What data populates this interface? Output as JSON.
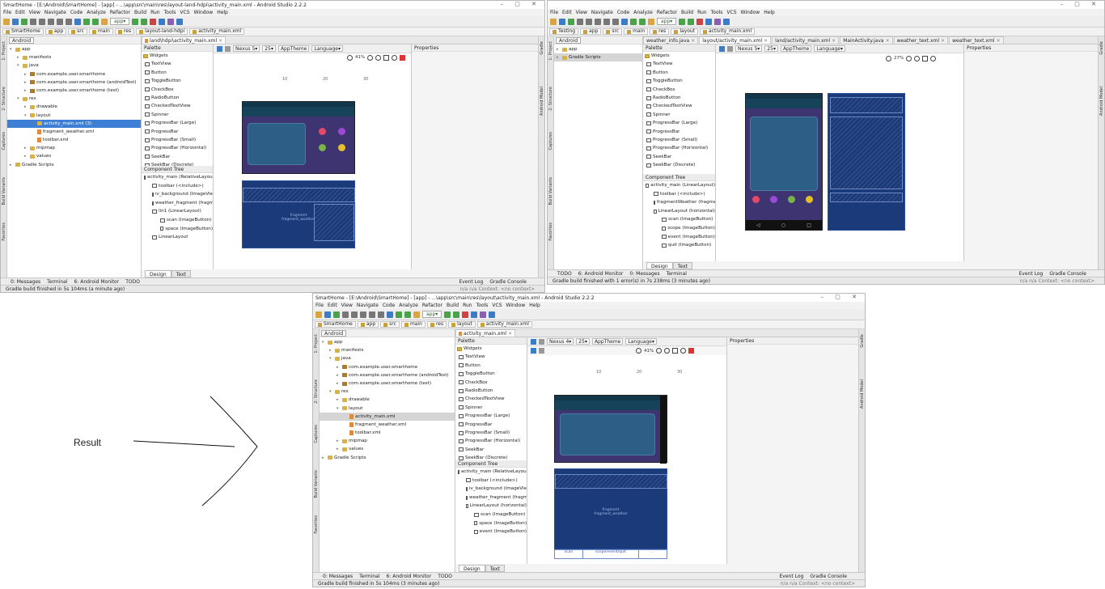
{
  "result_label": "Result",
  "menu": [
    "File",
    "Edit",
    "View",
    "Navigate",
    "Code",
    "Analyze",
    "Refactor",
    "Build",
    "Run",
    "Tools",
    "VCS",
    "Window",
    "Help"
  ],
  "app_selector": "app",
  "win1": {
    "title": "SmartHome - [E:\\Android\\SmartHome] - [app] - ...\\app\\src\\main\\res\\layout-land-hdpi\\activity_main.xml - Android Studio 2.2.2",
    "crumbs": [
      "SmartHome",
      "app",
      "src",
      "main",
      "res",
      "layout-land-hdpi",
      "activity_main.xml"
    ],
    "project_dropdown": "Android",
    "editor_tab": "land\\hdpi\\activity_main.xml",
    "tree": [
      {
        "label": "app",
        "depth": 0,
        "arrow": "▾",
        "icon": "fo"
      },
      {
        "label": "manifests",
        "depth": 1,
        "arrow": "▸",
        "icon": "fo"
      },
      {
        "label": "java",
        "depth": 1,
        "arrow": "▾",
        "icon": "fo"
      },
      {
        "label": "com.example.user.smarthome",
        "depth": 2,
        "arrow": "▸",
        "icon": "pk"
      },
      {
        "label": "com.example.user.smarthome (androidTest)",
        "depth": 2,
        "arrow": "▸",
        "icon": "pk"
      },
      {
        "label": "com.example.user.smarthome (test)",
        "depth": 2,
        "arrow": "▸",
        "icon": "pk"
      },
      {
        "label": "res",
        "depth": 1,
        "arrow": "▾",
        "icon": "fo"
      },
      {
        "label": "drawable",
        "depth": 2,
        "arrow": "▸",
        "icon": "fo"
      },
      {
        "label": "layout",
        "depth": 2,
        "arrow": "▾",
        "icon": "fo"
      },
      {
        "label": "activity_main.xml (3)",
        "depth": 3,
        "arrow": "▸",
        "icon": "fo",
        "sel": true
      },
      {
        "label": "fragment_weather.xml",
        "depth": 3,
        "arrow": "",
        "icon": "xm"
      },
      {
        "label": "toolbar.xml",
        "depth": 3,
        "arrow": "",
        "icon": "xm"
      },
      {
        "label": "mipmap",
        "depth": 2,
        "arrow": "▸",
        "icon": "fo"
      },
      {
        "label": "values",
        "depth": 2,
        "arrow": "▸",
        "icon": "fo"
      },
      {
        "label": "Gradle Scripts",
        "depth": 0,
        "arrow": "▸",
        "icon": "fo"
      }
    ],
    "palette_title": "Palette",
    "palette": [
      {
        "label": "Widgets",
        "cat": true
      },
      {
        "label": "TextView"
      },
      {
        "label": "Button"
      },
      {
        "label": "ToggleButton"
      },
      {
        "label": "CheckBox"
      },
      {
        "label": "RadioButton"
      },
      {
        "label": "CheckedTextView"
      },
      {
        "label": "Spinner"
      },
      {
        "label": "ProgressBar (Large)"
      },
      {
        "label": "ProgressBar"
      },
      {
        "label": "ProgressBar (Small)"
      },
      {
        "label": "ProgressBar (Horizontal)"
      },
      {
        "label": "SeekBar"
      },
      {
        "label": "SeekBar (Discrete)"
      }
    ],
    "ctree_title": "Component Tree",
    "ctree": [
      {
        "label": "activity_main (RelativeLayout)",
        "depth": 0
      },
      {
        "label": "toolbar (<include>)",
        "depth": 1
      },
      {
        "label": "iv_background (ImageView)",
        "depth": 1
      },
      {
        "label": "weather_fragment (fragment)",
        "depth": 1
      },
      {
        "label": "lin1 (LinearLayout)",
        "depth": 1
      },
      {
        "label": "scan (ImageButton)",
        "depth": 2
      },
      {
        "label": "space (ImageButton)",
        "depth": 2
      },
      {
        "label": "LinearLayout",
        "depth": 1
      }
    ],
    "device": "Nexus 5",
    "api": "25",
    "theme": "AppTheme",
    "language": "Language",
    "zoom": "41%",
    "props_title": "Properties",
    "ruler": [
      "10",
      "20",
      "30"
    ],
    "fragment_label": "fragment\nfragment_weather",
    "design_tab": "Design",
    "text_tab": "Text",
    "bottom_tabs": [
      "0: Messages",
      "Terminal",
      "6: Android Monitor",
      "TODO"
    ],
    "right_bottom": [
      "Event Log",
      "Gradle Console"
    ],
    "status": "Gradle build finished in 5s 104ms (a minute ago)",
    "status_right": "n/a   n/a   Context: <no context>"
  },
  "win2": {
    "crumbs": [
      "Testing",
      "app",
      "src",
      "main",
      "res",
      "layout",
      "activity_main.xml"
    ],
    "project_dropdown": "Android",
    "editor_tabs": [
      "weather_info.java",
      "layout/activity_main.xml",
      "land/activity_main.xml",
      "MainActivity.java",
      "weather_text.xml",
      "weather_text.xml"
    ],
    "tree": [
      {
        "label": "app",
        "depth": 0,
        "arrow": "▸",
        "icon": "fo"
      },
      {
        "label": "Gradle Scripts",
        "depth": 0,
        "arrow": "▸",
        "icon": "fo",
        "sel2": true
      }
    ],
    "palette_title": "Palette",
    "palette": [
      {
        "label": "Widgets",
        "cat": true
      },
      {
        "label": "TextView"
      },
      {
        "label": "Button"
      },
      {
        "label": "ToggleButton"
      },
      {
        "label": "CheckBox"
      },
      {
        "label": "RadioButton"
      },
      {
        "label": "CheckedTextView"
      },
      {
        "label": "Spinner"
      },
      {
        "label": "ProgressBar (Large)"
      },
      {
        "label": "ProgressBar"
      },
      {
        "label": "ProgressBar (Small)"
      },
      {
        "label": "ProgressBar (Horizontal)"
      },
      {
        "label": "SeekBar"
      },
      {
        "label": "SeekBar (Discrete)"
      }
    ],
    "ctree_title": "Component Tree",
    "ctree": [
      {
        "label": "activity_main (LinearLayout)",
        "depth": 0
      },
      {
        "label": "toolbar (<include>)",
        "depth": 1
      },
      {
        "label": "fragmentWeather (fragment)",
        "depth": 1
      },
      {
        "label": "LinearLayout (horizontal)",
        "depth": 1
      },
      {
        "label": "scan (ImageButton)",
        "depth": 2
      },
      {
        "label": "scope (ImageButton)",
        "depth": 2
      },
      {
        "label": "event (ImageButton)",
        "depth": 2
      },
      {
        "label": "quit (ImageButton)",
        "depth": 2
      }
    ],
    "device": "Nexus 5",
    "api": "25",
    "theme": "AppTheme",
    "language": "Language",
    "zoom": "27%",
    "props_title": "Properties",
    "design_tab": "Design",
    "text_tab": "Text",
    "bottom_tabs": [
      "TODO",
      "6: Android Monitor",
      "0: Messages",
      "Terminal"
    ],
    "right_bottom": [
      "Event Log",
      "Gradle Console"
    ],
    "status": "Gradle build finished with 1 error(s) in 7s 238ms (3 minutes ago)",
    "status_right": "n/a   n/a   Context: <no context>"
  },
  "win3": {
    "title": "SmartHome - [E:\\Android\\SmartHome] - [app] - ...\\app\\src\\main\\res\\layout\\activity_main.xml - Android Studio 2.2.2",
    "crumbs": [
      "SmartHome",
      "app",
      "src",
      "main",
      "res",
      "layout",
      "activity_main.xml"
    ],
    "project_dropdown": "Android",
    "editor_tab": "activity_main.xml",
    "tree": [
      {
        "label": "app",
        "depth": 0,
        "arrow": "▾",
        "icon": "fo"
      },
      {
        "label": "manifests",
        "depth": 1,
        "arrow": "▸",
        "icon": "fo"
      },
      {
        "label": "java",
        "depth": 1,
        "arrow": "▾",
        "icon": "fo"
      },
      {
        "label": "com.example.user.smarthome",
        "depth": 2,
        "arrow": "▸",
        "icon": "pk"
      },
      {
        "label": "com.example.user.smarthome (androidTest)",
        "depth": 2,
        "arrow": "▸",
        "icon": "pk"
      },
      {
        "label": "com.example.user.smarthome (test)",
        "depth": 2,
        "arrow": "▸",
        "icon": "pk"
      },
      {
        "label": "res",
        "depth": 1,
        "arrow": "▾",
        "icon": "fo"
      },
      {
        "label": "drawable",
        "depth": 2,
        "arrow": "▸",
        "icon": "fo"
      },
      {
        "label": "layout",
        "depth": 2,
        "arrow": "▾",
        "icon": "fo"
      },
      {
        "label": "activity_main.xml",
        "depth": 3,
        "arrow": "",
        "icon": "xm",
        "sel2": true
      },
      {
        "label": "fragment_weather.xml",
        "depth": 3,
        "arrow": "",
        "icon": "xm"
      },
      {
        "label": "toolbar.xml",
        "depth": 3,
        "arrow": "",
        "icon": "xm"
      },
      {
        "label": "mipmap",
        "depth": 2,
        "arrow": "▸",
        "icon": "fo"
      },
      {
        "label": "values",
        "depth": 2,
        "arrow": "▸",
        "icon": "fo"
      },
      {
        "label": "Gradle Scripts",
        "depth": 0,
        "arrow": "▸",
        "icon": "fo"
      }
    ],
    "palette_title": "Palette",
    "palette": [
      {
        "label": "Widgets",
        "cat": true
      },
      {
        "label": "TextView"
      },
      {
        "label": "Button"
      },
      {
        "label": "ToggleButton"
      },
      {
        "label": "CheckBox"
      },
      {
        "label": "RadioButton"
      },
      {
        "label": "CheckedTextView"
      },
      {
        "label": "Spinner"
      },
      {
        "label": "ProgressBar (Large)"
      },
      {
        "label": "ProgressBar"
      },
      {
        "label": "ProgressBar (Small)"
      },
      {
        "label": "ProgressBar (Horizontal)"
      },
      {
        "label": "SeekBar"
      },
      {
        "label": "SeekBar (Discrete)"
      }
    ],
    "ctree_title": "Component Tree",
    "ctree": [
      {
        "label": "activity_main (RelativeLayout)",
        "depth": 0
      },
      {
        "label": "toolbar (<include>)",
        "depth": 1
      },
      {
        "label": "iv_background (ImageView)",
        "depth": 1
      },
      {
        "label": "weather_fragment (fragment)",
        "depth": 1
      },
      {
        "label": "LinearLayout (horizontal)",
        "depth": 1
      },
      {
        "label": "scan (ImageButton)",
        "depth": 2
      },
      {
        "label": "space (ImageButton)",
        "depth": 2
      },
      {
        "label": "event (ImageButton)",
        "depth": 2
      }
    ],
    "device": "Nexus 4",
    "api": "25",
    "theme": "AppTheme",
    "language": "Language",
    "zoom": "41%",
    "props_title": "Properties",
    "ruler": [
      "10",
      "20",
      "30"
    ],
    "fragment_label": "fragment\nfragment_weather",
    "strip": [
      "scan",
      "scope/event/quit",
      "..."
    ],
    "design_tab": "Design",
    "text_tab": "Text",
    "bottom_tabs": [
      "0: Messages",
      "Terminal",
      "6: Android Monitor",
      "TODO"
    ],
    "right_bottom": [
      "Event Log",
      "Gradle Console"
    ],
    "status": "Gradle build finished in 5s 104ms (3 minutes ago)",
    "status_right": "n/a   n/a   Context: <no context>"
  },
  "left_tabs": [
    "1: Project",
    "2: Structure",
    "Captures",
    "Build Variants",
    "Favorites"
  ],
  "right_tabs": [
    "Gradle",
    "Android Model"
  ]
}
